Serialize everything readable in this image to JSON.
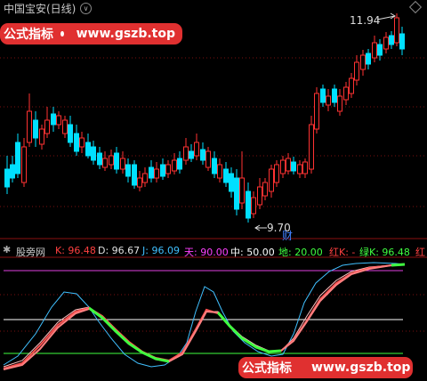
{
  "header": {
    "title": "中国宝安(日线)",
    "collapse_glyph": "∨"
  },
  "price_chart": {
    "high_label": "11.94",
    "low_label": "9.70",
    "event_marker": "财",
    "up_color": "#ff3232",
    "down_color": "#00e0ff"
  },
  "banners": {
    "top": {
      "brand": "公式指标",
      "url": "www.gszb.top"
    },
    "bottom": {
      "brand": "公式指标",
      "url": "www.gszb.top"
    }
  },
  "indicator": {
    "name": "股旁网",
    "values": [
      {
        "label": "K: 96.48",
        "color": "#ff4040"
      },
      {
        "label": "D: 96.67",
        "color": "#e0e0e0"
      },
      {
        "label": "J: 96.09",
        "color": "#40c0ff"
      },
      {
        "label": "天: 90.00",
        "color": "#ff40ff"
      },
      {
        "label": "中: 50.00",
        "color": "#ffffff"
      },
      {
        "label": "地: 20.00",
        "color": "#40ff40"
      },
      {
        "label": "红K: -",
        "color": "#ff4040"
      },
      {
        "label": "绿K: 96.48",
        "color": "#40ff40"
      },
      {
        "label": "红",
        "color": "#ff4040"
      }
    ]
  }
}
